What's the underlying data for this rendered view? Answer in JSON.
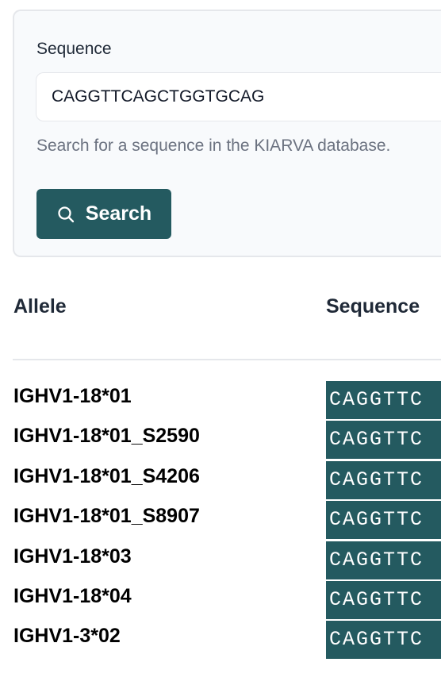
{
  "search_form": {
    "field_label": "Sequence",
    "input_value": "CAGGTTCAGCTGGTGCAG",
    "helper_text": "Search for a sequence in the KIARVA database.",
    "button_label": "Search",
    "button_icon": "search-icon"
  },
  "results": {
    "headers": {
      "allele": "Allele",
      "sequence": "Sequence"
    },
    "rows": [
      {
        "allele": "IGHV1-18*01",
        "sequence": "CAGGTTC"
      },
      {
        "allele": "IGHV1-18*01_S2590",
        "sequence": "CAGGTTC"
      },
      {
        "allele": "IGHV1-18*01_S4206",
        "sequence": "CAGGTTC"
      },
      {
        "allele": "IGHV1-18*01_S8907",
        "sequence": "CAGGTTC"
      },
      {
        "allele": "IGHV1-18*03",
        "sequence": "CAGGTTC"
      },
      {
        "allele": "IGHV1-18*04",
        "sequence": "CAGGTTC"
      },
      {
        "allele": "IGHV1-3*02",
        "sequence": "CAGGTTC"
      }
    ]
  },
  "colors": {
    "accent": "#245a60",
    "card_background": "#f8fafc",
    "border": "#e5e7eb",
    "muted_text": "#6b7280"
  }
}
